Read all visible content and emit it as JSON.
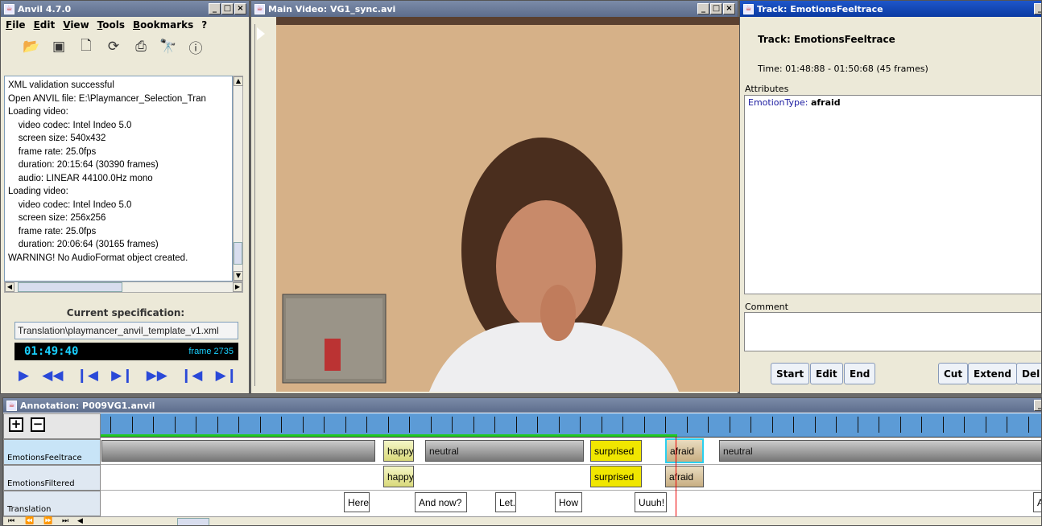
{
  "anvil_window": {
    "title": "Anvil 4.7.0",
    "menu": [
      {
        "key": "F",
        "rest": "ile"
      },
      {
        "key": "E",
        "rest": "dit"
      },
      {
        "key": "V",
        "rest": "iew"
      },
      {
        "key": "T",
        "rest": "ools"
      },
      {
        "key": "B",
        "rest": "ookmarks"
      },
      {
        "key": "?",
        "rest": ""
      }
    ],
    "log_lines": [
      "XML validation successful",
      "Open ANVIL file: E:\\Playmancer_Selection_Tran",
      "Loading video:",
      "    video codec: Intel Indeo 5.0",
      "    screen size: 540x432",
      "    frame rate: 25.0fps",
      "    duration: 20:15:64 (30390 frames)",
      "    audio: LINEAR 44100.0Hz mono",
      "Loading video:",
      "    video codec: Intel Indeo 5.0",
      "    screen size: 256x256",
      "    frame rate: 25.0fps",
      "    duration: 20:06:64 (30165 frames)",
      "WARNING! No AudioFormat object created."
    ],
    "spec_title": "Current specification:",
    "spec_file": "Translation\\playmancer_anvil_template_v1.xml",
    "time": "01:49:40",
    "frame": "frame 2735"
  },
  "video_window": {
    "title": "Main Video: VG1_sync.avi"
  },
  "track_window": {
    "title": "Track: EmotionsFeeltrace",
    "heading": "Track: EmotionsFeeltrace",
    "time": "Time: 01:48:88 - 01:50:68 (45 frames)",
    "attributes_label": "Attributes",
    "attr_key": "EmotionType:",
    "attr_value": "afraid",
    "comment_label": "Comment",
    "buttons": {
      "start": "Start",
      "edit": "Edit",
      "end": "End",
      "cut": "Cut",
      "extend": "Extend",
      "delete": "Del"
    }
  },
  "annotation_window": {
    "title": "Annotation: P009VG1.anvil",
    "zoom_in": "+",
    "zoom_out": "−",
    "tracks": [
      {
        "name": "EmotionsFeeltrace"
      },
      {
        "name": "EmotionsFiltered"
      },
      {
        "name": "Translation"
      }
    ],
    "feeltrace_segments": [
      "happy",
      "neutral",
      "surprised",
      "afraid",
      "neutral"
    ],
    "filtered_segments": [
      "happy",
      "surprised",
      "afraid"
    ],
    "translation_segments": [
      "Here",
      "And now?",
      "Let.",
      "How",
      "Uuuh!",
      "A"
    ]
  }
}
